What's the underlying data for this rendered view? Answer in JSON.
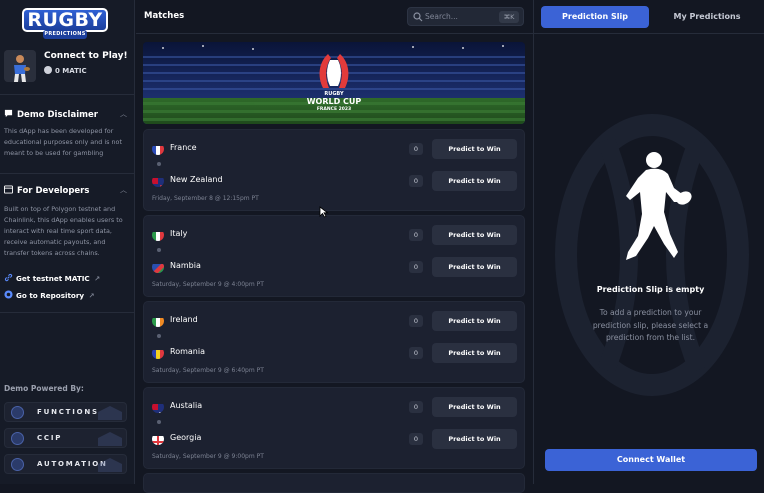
{
  "sidebar": {
    "logo_main": "RUGBY",
    "logo_sub": "PREDICTIONS",
    "connect_title": "Connect to Play!",
    "matic_balance": "0 MATIC",
    "disclaimer_title": "Demo Disclaimer",
    "disclaimer_text": "This dApp has been developed for educational purposes only and is not meant to be used for gambling",
    "developers_title": "For Developers",
    "developers_text": "Built on top of Polygon testnet and Chainlink, this dApp enables users to interact with real time sport data, receive automatic payouts, and transfer tokens across chains.",
    "link_testnet": "Get testnet MATIC",
    "link_repo": "Go to Repository",
    "powered_by": "Demo Powered By:",
    "services": [
      "FUNCTIONS",
      "CCIP",
      "AUTOMATION"
    ]
  },
  "header": {
    "matches_title": "Matches",
    "search_placeholder": "Search...",
    "search_shortcut": "⌘K"
  },
  "banner": {
    "line1": "RUGBY",
    "line2": "WORLD CUP",
    "line3": "FRANCE 2023"
  },
  "matches": [
    {
      "team1": "France",
      "team1_count": "0",
      "team2": "New Zealand",
      "team2_count": "0",
      "date": "Friday, September 8 @ 12:15pm PT"
    },
    {
      "team1": "Italy",
      "team1_count": "0",
      "team2": "Nambia",
      "team2_count": "0",
      "date": "Saturday, September 9 @ 4:00pm PT"
    },
    {
      "team1": "Ireland",
      "team1_count": "0",
      "team2": "Romania",
      "team2_count": "0",
      "date": "Saturday, September 9 @ 6:40pm PT"
    },
    {
      "team1": "Austalia",
      "team1_count": "0",
      "team2": "Georgia",
      "team2_count": "0",
      "date": "Saturday, September 9 @ 9:00pm PT"
    }
  ],
  "predict_label": "Predict to Win",
  "right_panel": {
    "tab_active": "Prediction Slip",
    "tab_other": "My Predictions",
    "empty_title": "Prediction Slip is empty",
    "empty_text": "To add a prediction to your prediction slip, please select a prediction from the list.",
    "connect_wallet": "Connect Wallet"
  },
  "colors": {
    "accent": "#3b63d6",
    "background": "#131722",
    "card": "#1c2130"
  }
}
